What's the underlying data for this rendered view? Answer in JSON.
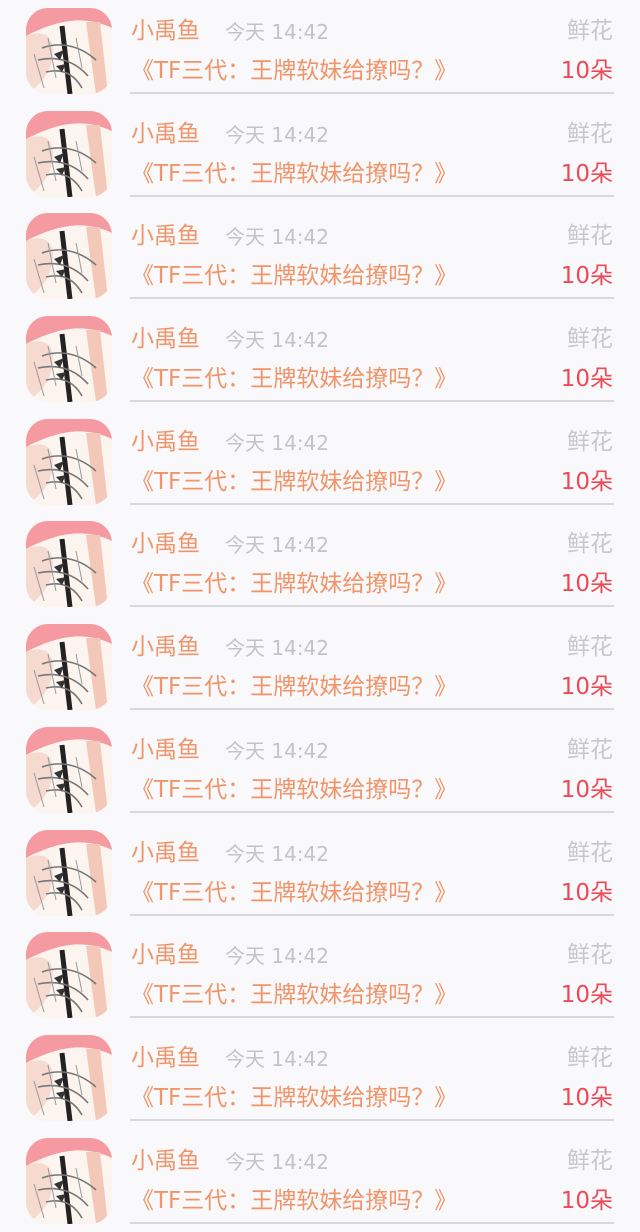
{
  "colors": {
    "background": "#f9f8fa",
    "name": "#f0956a",
    "title": "#f0956a",
    "time": "#c4c4c4",
    "gift_type": "#c8c8c8",
    "gift_count": "#ec4a56",
    "divider": "#d9d9d9"
  },
  "records": [
    {
      "name": "小禹鱼",
      "time": "今天 14:42",
      "title": "《TF三代：王牌软妹给撩吗？》",
      "gift_type": "鲜花",
      "gift_count": "10朵",
      "avatar_icon": "anime-avatar-icon"
    },
    {
      "name": "小禹鱼",
      "time": "今天 14:42",
      "title": "《TF三代：王牌软妹给撩吗？》",
      "gift_type": "鲜花",
      "gift_count": "10朵",
      "avatar_icon": "anime-avatar-icon"
    },
    {
      "name": "小禹鱼",
      "time": "今天 14:42",
      "title": "《TF三代：王牌软妹给撩吗？》",
      "gift_type": "鲜花",
      "gift_count": "10朵",
      "avatar_icon": "anime-avatar-icon"
    },
    {
      "name": "小禹鱼",
      "time": "今天 14:42",
      "title": "《TF三代：王牌软妹给撩吗？》",
      "gift_type": "鲜花",
      "gift_count": "10朵",
      "avatar_icon": "anime-avatar-icon"
    },
    {
      "name": "小禹鱼",
      "time": "今天 14:42",
      "title": "《TF三代：王牌软妹给撩吗？》",
      "gift_type": "鲜花",
      "gift_count": "10朵",
      "avatar_icon": "anime-avatar-icon"
    },
    {
      "name": "小禹鱼",
      "time": "今天 14:42",
      "title": "《TF三代：王牌软妹给撩吗？》",
      "gift_type": "鲜花",
      "gift_count": "10朵",
      "avatar_icon": "anime-avatar-icon"
    },
    {
      "name": "小禹鱼",
      "time": "今天 14:42",
      "title": "《TF三代：王牌软妹给撩吗？》",
      "gift_type": "鲜花",
      "gift_count": "10朵",
      "avatar_icon": "anime-avatar-icon"
    },
    {
      "name": "小禹鱼",
      "time": "今天 14:42",
      "title": "《TF三代：王牌软妹给撩吗？》",
      "gift_type": "鲜花",
      "gift_count": "10朵",
      "avatar_icon": "anime-avatar-icon"
    },
    {
      "name": "小禹鱼",
      "time": "今天 14:42",
      "title": "《TF三代：王牌软妹给撩吗？》",
      "gift_type": "鲜花",
      "gift_count": "10朵",
      "avatar_icon": "anime-avatar-icon"
    },
    {
      "name": "小禹鱼",
      "time": "今天 14:42",
      "title": "《TF三代：王牌软妹给撩吗？》",
      "gift_type": "鲜花",
      "gift_count": "10朵",
      "avatar_icon": "anime-avatar-icon"
    },
    {
      "name": "小禹鱼",
      "time": "今天 14:42",
      "title": "《TF三代：王牌软妹给撩吗？》",
      "gift_type": "鲜花",
      "gift_count": "10朵",
      "avatar_icon": "anime-avatar-icon"
    },
    {
      "name": "小禹鱼",
      "time": "今天 14:42",
      "title": "《TF三代：王牌软妹给撩吗？》",
      "gift_type": "鲜花",
      "gift_count": "10朵",
      "avatar_icon": "anime-avatar-icon"
    }
  ]
}
